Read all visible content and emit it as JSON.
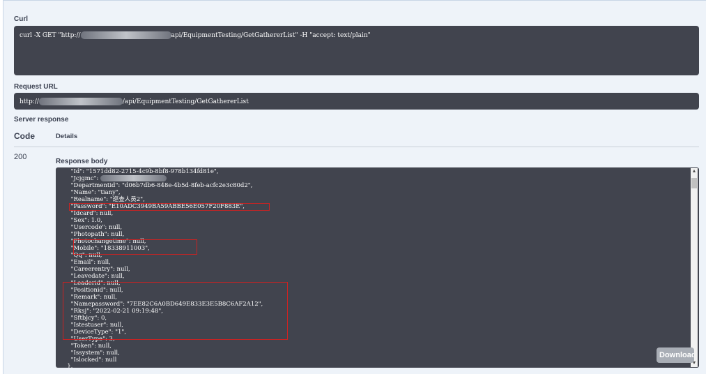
{
  "curl": {
    "label": "Curl",
    "command_prefix": "curl -X GET \"http://",
    "command_suffix": "api/EquipmentTesting/GetGathererList\" -H \"accept: text/plain\""
  },
  "request_url": {
    "label": "Request URL",
    "prefix": "http://",
    "suffix": "/api/EquipmentTesting/GetGathererList"
  },
  "server_response": {
    "label": "Server response",
    "code_header": "Code",
    "details_header": "Details",
    "status_code": "200",
    "response_body_label": "Response body",
    "lines": [
      "        \"Id\": \"1571dd82-2715-4c9b-8bf8-978b134fd81e\",",
      "        \"Jcjgmc\":",
      "        \"Departmentid\": \"d06b7db6-848e-4b5d-8feb-acfc2e3c80d2\",",
      "        \"Name\": \"tiany\",",
      "        \"Realname\": \"巡查人员2\",",
      "        \"Password\": \"E10ADC3949BA59ABBE56E057F20F883E\",",
      "        \"Idcard\": null,",
      "        \"Sex\": 1.0,",
      "        \"Usercode\": null,",
      "        \"Photopath\": null,",
      "        \"Photochangetime\": null,",
      "        \"Mobile\": \"18338911003\",",
      "        \"Qq\": null,",
      "        \"Email\": null,",
      "        \"Careerentry\": null,",
      "        \"Leavedate\": null,",
      "        \"Leaderid\": null,",
      "        \"Positionid\": null,",
      "        \"Remark\": null,",
      "        \"Namepassword\": \"7EE82C6A0BD649E833E3E5B8C6AF2A12\",",
      "        \"Rksj\": \"2022-02-21 09:19:48\",",
      "        \"Sftbjcy\": 0,",
      "        \"Istestuser\": null,",
      "        \"DeviceType\": \"1\",",
      "        \"UserType\": 3,",
      "        \"Token\": null,",
      "        \"Issystem\": null,",
      "        \"Islocked\": null",
      "      },"
    ],
    "download_label": "Download"
  },
  "colors": {
    "code_background": "#41444e",
    "highlight_box": "#cc2222",
    "panel_background": "#eef3f9"
  }
}
